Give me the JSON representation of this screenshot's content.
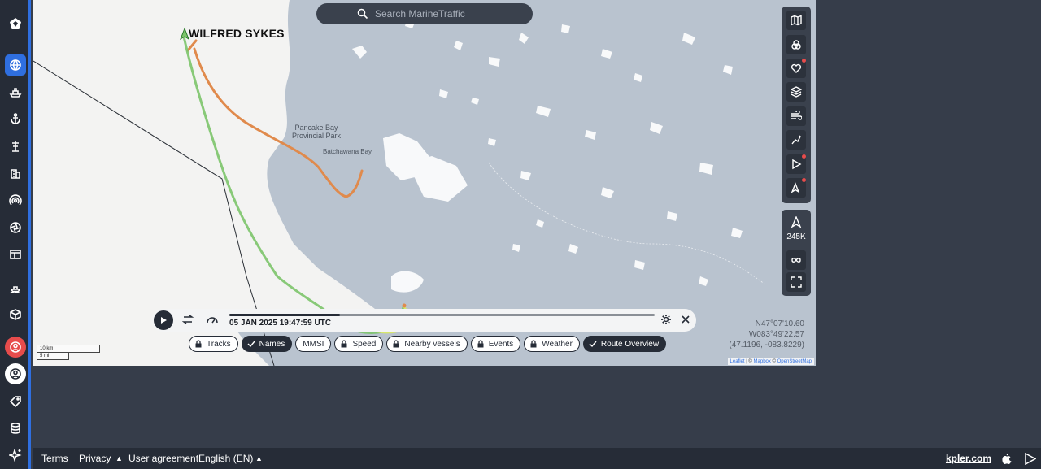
{
  "search": {
    "placeholder": "Search MarineTraffic"
  },
  "sidebar": {
    "items": [
      {
        "icon": "logo-icon"
      },
      {
        "icon": "globe-icon",
        "active": true
      },
      {
        "icon": "ship-icon"
      },
      {
        "icon": "anchor-icon"
      },
      {
        "icon": "port-crane-icon"
      },
      {
        "icon": "building-icon"
      },
      {
        "icon": "signal-icon"
      },
      {
        "icon": "aperture-icon"
      },
      {
        "icon": "dashboard-icon"
      },
      {
        "icon": "ship-wave-icon"
      },
      {
        "icon": "cube-icon"
      },
      {
        "icon": "user-alert-icon"
      },
      {
        "icon": "account-icon"
      },
      {
        "icon": "tag-icon"
      },
      {
        "icon": "database-icon"
      },
      {
        "icon": "sparkle-icon"
      }
    ]
  },
  "map": {
    "vessel_name": "WILFRED SYKES",
    "places": [
      {
        "name": "Pancake Bay",
        "sub": "Provincial Park"
      },
      {
        "name": "Batchawana Bay"
      }
    ],
    "zoom_readout": "245K",
    "coordinates": {
      "lat": "N47°07'10.60",
      "lon": "W083°49'22.57",
      "decimal": "(47.1196, -083.8229)"
    },
    "scale": {
      "km": "10 km",
      "mi": "5 mi"
    },
    "attribution": {
      "leaflet": "Leaflet",
      "sep1": " | © ",
      "mapbox": "Mapbox",
      "sep2": " © ",
      "osm": "OpenStreetMap"
    },
    "colors": {
      "land": "#f3f3f2",
      "water": "#b9c3cf",
      "track_green": "#7cc46a",
      "track_orange": "#e08a4c"
    }
  },
  "playback": {
    "datetime": "05 JAN 2025 19:47:59 UTC",
    "progress": 0.26
  },
  "chips": [
    {
      "label": "Tracks",
      "locked": true,
      "active": false
    },
    {
      "label": "Names",
      "locked": false,
      "active": true
    },
    {
      "label": "MMSI",
      "locked": false,
      "active": false
    },
    {
      "label": "Speed",
      "locked": true,
      "active": false
    },
    {
      "label": "Nearby vessels",
      "locked": true,
      "active": false
    },
    {
      "label": "Events",
      "locked": true,
      "active": false
    },
    {
      "label": "Weather",
      "locked": true,
      "active": false
    },
    {
      "label": "Route Overview",
      "locked": false,
      "active": true
    }
  ],
  "footer": {
    "terms": "Terms",
    "privacy": "Privacy",
    "user_agreement": "User agreement",
    "language": "English (EN)",
    "kpler": "kpler.com"
  }
}
